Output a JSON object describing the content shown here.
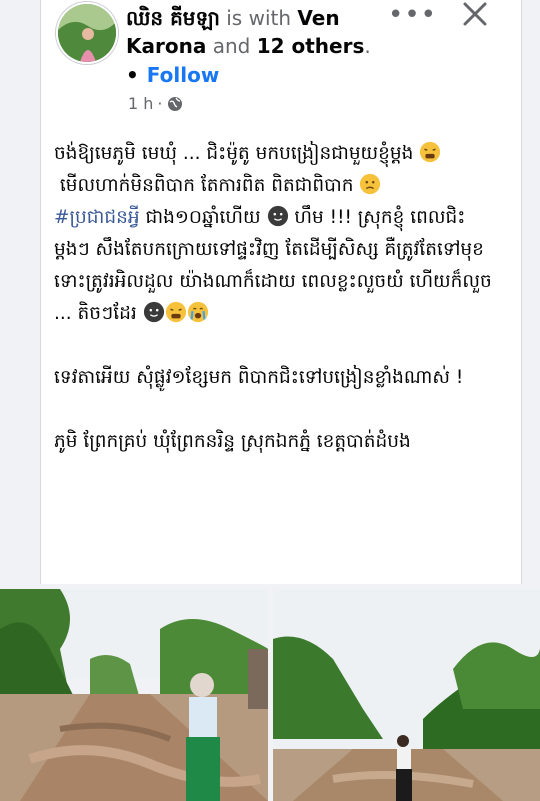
{
  "post": {
    "author": "ឈិន គីមឡា",
    "with_text": "is with",
    "tagged_name": "Ven Karona",
    "and_text": "and",
    "others": "12 others",
    "period": ".",
    "follow_dot": "•",
    "follow_label": "Follow",
    "timestamp": "1 h",
    "time_separator": "·",
    "privacy_icon": "globe-icon",
    "more_label": "•••",
    "lines": {
      "l1": "ចង់ឱ្យមេភូមិ មេឃុំ ... ជិះម៉ូតូ មកបង្រៀនជាមួយខ្ញុំម្ដង ",
      "l2": " មើលហាក់មិនពិបាក តែការពិត ពិតជាពិបាក ",
      "hashtag": "#ប្រជាជនអ្វី",
      "l3": " ជាង១០ឆ្នាំហើយ ",
      "l3b": " ហឹម !!! ស្រុកខ្ញុំ ពេលជិះម្ដងៗ សឹងតែបកក្រោយទៅផ្ទះវិញ តែដើម្បីសិស្ស គឺត្រូវតែទៅមុខ ទោះត្រូវរអិលដួល យ៉ាងណាក៏ដោយ ពេលខ្លះលួចយំ ហើយក៏លួច ... តិចៗដែរ ",
      "l4": "ទេវតាអើយ សុំផ្លូវ១ខ្សែមក ពិបាកជិះទៅបង្រៀនខ្លាំងណាស់ !",
      "l5": "ភូមិ ព្រែកគ្រប់ ឃុំព្រែកនរិន្ទ ស្រុកឯកភ្នំ ខេត្តបាត់ដំបង"
    }
  },
  "colors": {
    "link": "#1877f2",
    "hashtag": "#385898",
    "meta": "#65676b"
  }
}
